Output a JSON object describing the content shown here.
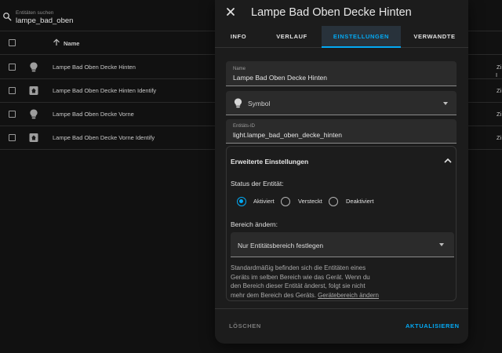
{
  "search": {
    "label": "Entitäten suchen",
    "value": "lampe_bad_oben"
  },
  "table": {
    "header_name": "Name",
    "header_right": "I",
    "rows": [
      {
        "icon": "lightbulb-icon",
        "name": "Lampe Bad Oben Decke Hinten",
        "right": "Zi"
      },
      {
        "icon": "identify-icon",
        "name": "Lampe Bad Oben Decke Hinten Identify",
        "right": "Zi"
      },
      {
        "icon": "lightbulb-icon",
        "name": "Lampe Bad Oben Decke Vorne",
        "right": "Zi"
      },
      {
        "icon": "identify-icon",
        "name": "Lampe Bad Oben Decke Vorne Identify",
        "right": "Zi"
      }
    ]
  },
  "dialog": {
    "title": "Lampe Bad Oben Decke Hinten",
    "tabs": [
      "INFO",
      "VERLAUF",
      "EINSTELLUNGEN",
      "VERWANDTE"
    ],
    "active_tab": "EINSTELLUNGEN",
    "name_field": {
      "label": "Name",
      "value": "Lampe Bad Oben Decke Hinten"
    },
    "icon_field": {
      "icon": "lightbulb-icon",
      "label": "Symbol"
    },
    "entity_id_field": {
      "label": "Entitäts-ID",
      "value": "light.lampe_bad_oben_decke_hinten"
    },
    "advanced": {
      "title": "Erweiterte Einstellungen",
      "status_label": "Status der Entität:",
      "status_options": [
        "Aktiviert",
        "Versteckt",
        "Deaktiviert"
      ],
      "status_selected": "Aktiviert",
      "area_label": "Bereich ändern:",
      "area_value": "Nur Entitätsbereich festlegen",
      "help_lines": [
        "Standardmäßig befinden sich die Entitäten eines",
        "Geräts im selben Bereich wie das Gerät. Wenn du",
        "den Bereich dieser Entität änderst, folgt sie nicht",
        "mehr dem Bereich des Geräts."
      ],
      "help_link": "Gerätebereich ändern"
    },
    "footer": {
      "delete": "LÖSCHEN",
      "update": "AKTUALISIEREN"
    }
  },
  "colors": {
    "accent": "#03a9f4",
    "background": "#111111",
    "dialog": "#1c1c1c"
  }
}
